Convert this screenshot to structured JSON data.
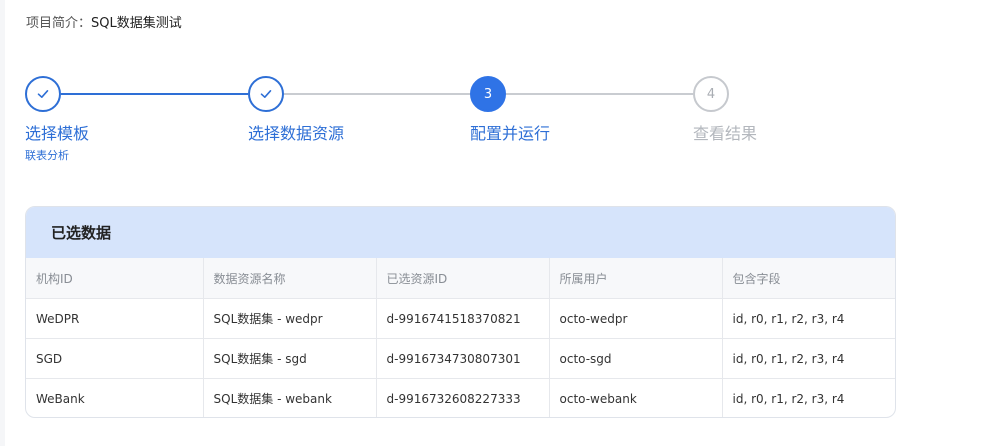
{
  "project": {
    "label": "项目简介：",
    "value": "SQL数据集测试"
  },
  "steps": [
    {
      "number": "1",
      "title": "选择模板",
      "subtitle": "联表分析",
      "status": "done"
    },
    {
      "number": "2",
      "title": "选择数据资源",
      "subtitle": "",
      "status": "done"
    },
    {
      "number": "3",
      "title": "配置并运行",
      "subtitle": "",
      "status": "active"
    },
    {
      "number": "4",
      "title": "查看结果",
      "subtitle": "",
      "status": "todo"
    }
  ],
  "colors": {
    "primary": "#2e6fd6",
    "active": "#2f73e6",
    "inactive": "#c6c9ce",
    "panel_header": "#d6e4fb"
  },
  "panel": {
    "title": "已选数据",
    "columns": [
      "机构ID",
      "数据资源名称",
      "已选资源ID",
      "所属用户",
      "包含字段"
    ],
    "rows": [
      [
        "WeDPR",
        "SQL数据集 - wedpr",
        "d-9916741518370821",
        "octo-wedpr",
        "id, r0, r1, r2, r3, r4"
      ],
      [
        "SGD",
        "SQL数据集 - sgd",
        "d-9916734730807301",
        "octo-sgd",
        "id, r0, r1, r2, r3, r4"
      ],
      [
        "WeBank",
        "SQL数据集 - webank",
        "d-9916732608227333",
        "octo-webank",
        "id, r0, r1, r2, r3, r4"
      ]
    ]
  }
}
